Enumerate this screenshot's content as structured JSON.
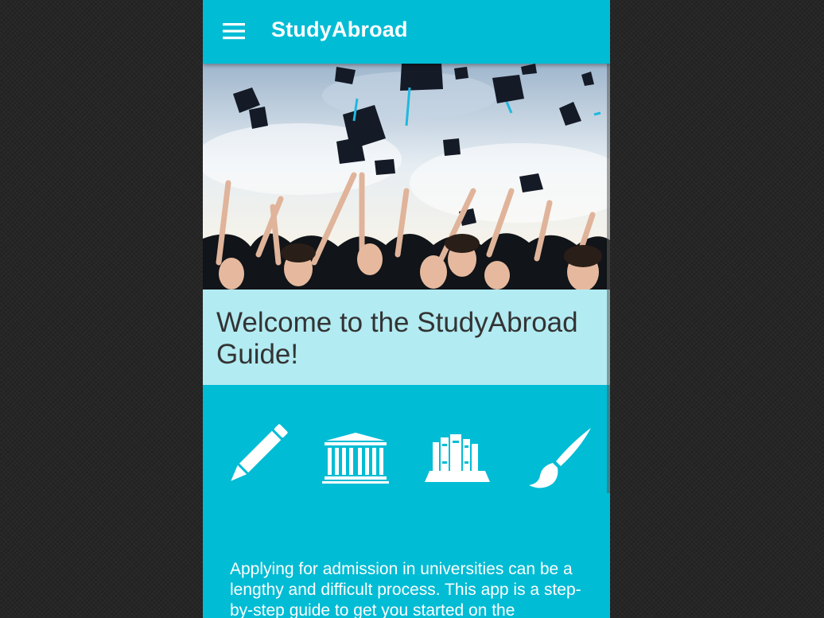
{
  "app_bar": {
    "title": "StudyAbroad",
    "menu_icon": "hamburger-menu-icon",
    "color": "#00bcd4"
  },
  "hero": {
    "image": "graduates-throwing-caps-photo"
  },
  "welcome": {
    "title": "Welcome to the StudyAbroad Guide!",
    "background": "#b2ebf2"
  },
  "features": [
    {
      "icon": "pencil-icon"
    },
    {
      "icon": "university-building-icon"
    },
    {
      "icon": "books-icon"
    },
    {
      "icon": "paintbrush-icon"
    }
  ],
  "intro": {
    "text": "Applying for admission in universities can be a lengthy and difficult process. This app is a step-by-step guide to get you started on the"
  },
  "colors": {
    "primary": "#00bcd4",
    "light_primary": "#b2ebf2",
    "background": "#262626"
  }
}
